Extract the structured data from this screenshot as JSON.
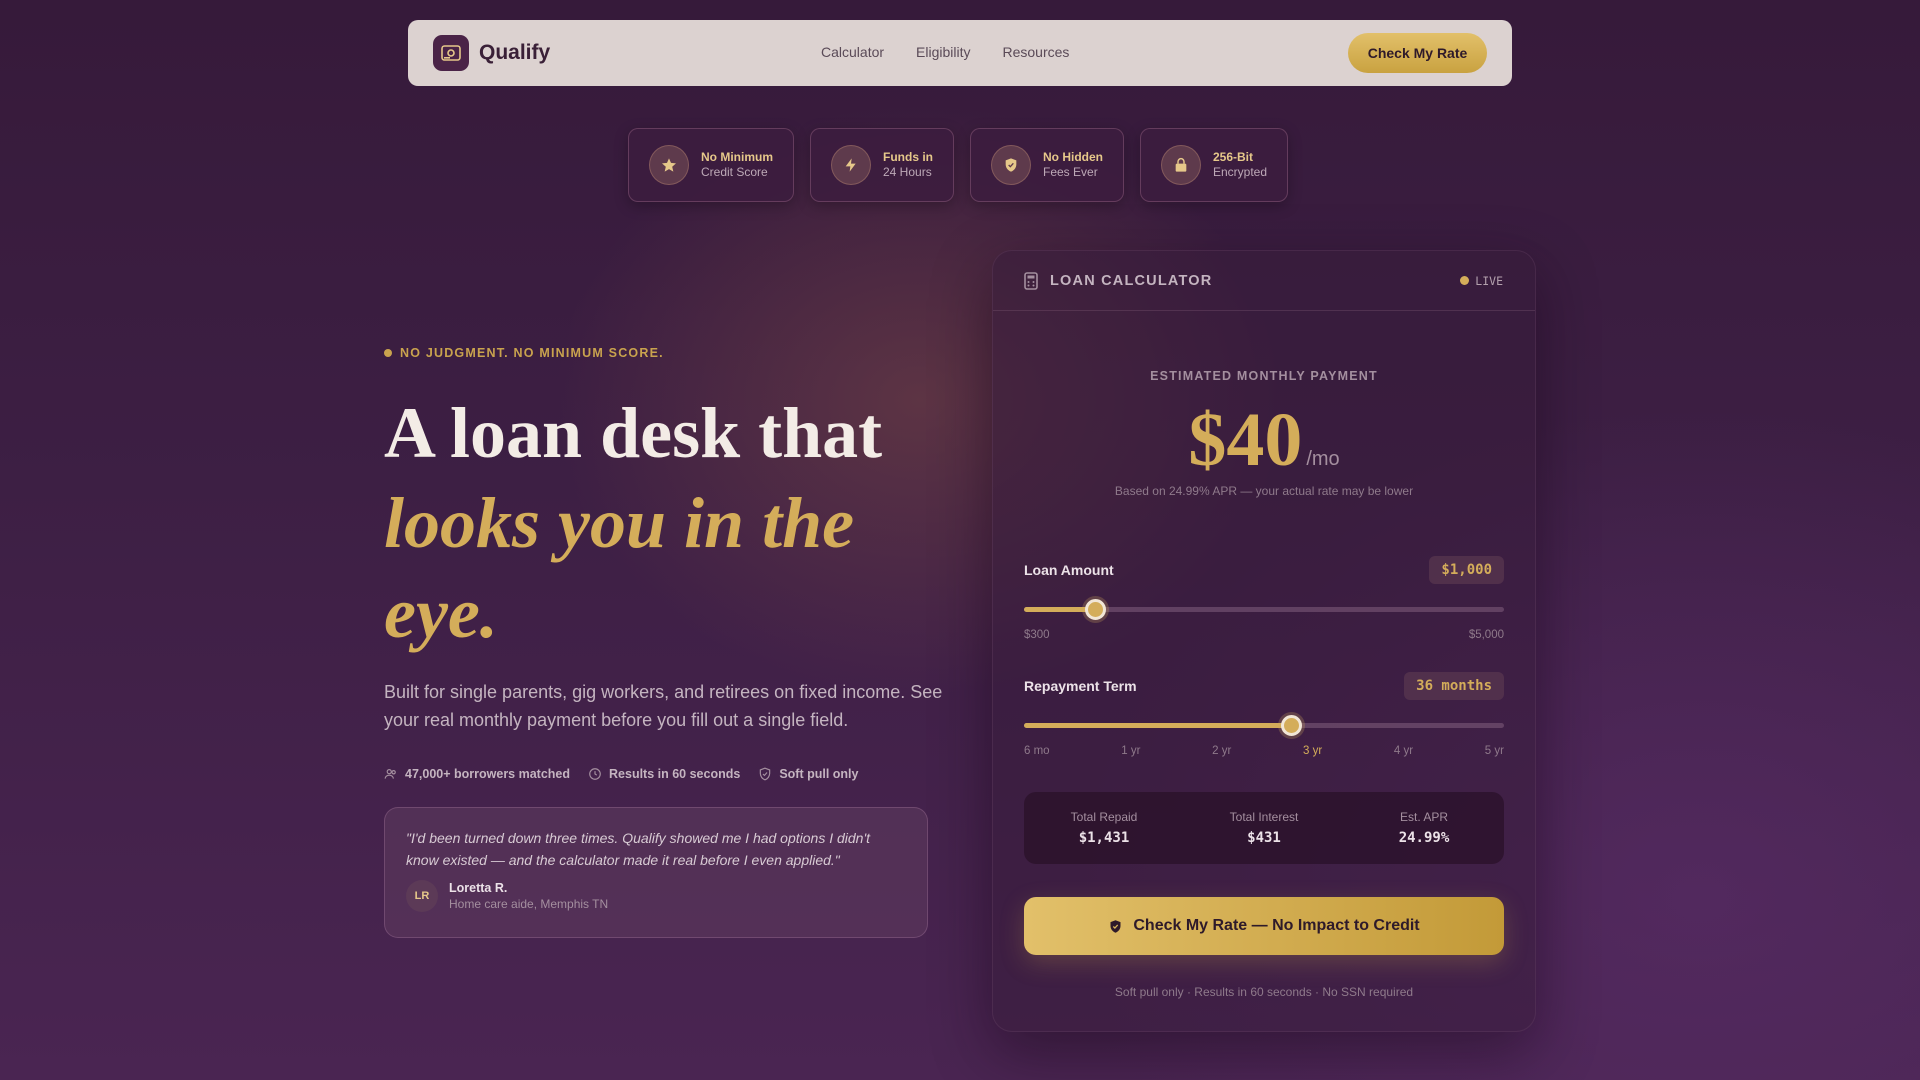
{
  "nav": {
    "brand": "Qualify",
    "links": [
      "Calculator",
      "Eligibility",
      "Resources"
    ],
    "cta": "Check My Rate"
  },
  "badges": [
    {
      "icon": "star-icon",
      "title": "No Minimum",
      "sub": "Credit Score"
    },
    {
      "icon": "lightning-icon",
      "title": "Funds in",
      "sub": "24 Hours"
    },
    {
      "icon": "shield-check-icon",
      "title": "No Hidden",
      "sub": "Fees Ever"
    },
    {
      "icon": "lock-icon",
      "title": "256-Bit",
      "sub": "Encrypted"
    }
  ],
  "hero": {
    "eyebrow": "NO JUDGMENT. NO MINIMUM SCORE.",
    "headline_line1": "A loan desk that",
    "headline_line2": "looks you in the eye.",
    "subhead": "Built for single parents, gig workers, and retirees on fixed income. See your real monthly payment before you fill out a single field.",
    "stats": [
      {
        "icon": "users-icon",
        "text": "47,000+ borrowers matched"
      },
      {
        "icon": "clock-icon",
        "text": "Results in 60 seconds"
      },
      {
        "icon": "shield-icon",
        "text": "Soft pull only"
      }
    ]
  },
  "testimonial": {
    "quote": "\"I'd been turned down three times. Qualify showed me I had options I didn't know existed — and the calculator made it real before I even applied.\"",
    "initials": "LR",
    "name": "Loretta R.",
    "role": "Home care aide, Memphis TN"
  },
  "calculator": {
    "title": "LOAN CALCULATOR",
    "status": "LIVE",
    "payment_label": "ESTIMATED MONTHLY PAYMENT",
    "payment_amount": "$40",
    "payment_suffix": "/mo",
    "payment_note": "Based on 24.99% APR — your actual rate may be lower",
    "loan_amount": {
      "label": "Loan Amount",
      "value": "$1,000",
      "min_label": "$300",
      "max_label": "$5,000",
      "min": 300,
      "max": 5000,
      "current": 1000
    },
    "term": {
      "label": "Repayment Term",
      "value": "36 months",
      "ticks": [
        "6 mo",
        "1 yr",
        "2 yr",
        "3 yr",
        "4 yr",
        "5 yr"
      ],
      "active_tick": 3,
      "min": 6,
      "max": 60,
      "current": 36
    },
    "summary": [
      {
        "label": "Total Repaid",
        "value": "$1,431"
      },
      {
        "label": "Total Interest",
        "value": "$431"
      },
      {
        "label": "Est. APR",
        "value": "24.99%"
      }
    ],
    "cta": "Check My Rate — No Impact to Credit",
    "footnote": "Soft pull only · Results in 60 seconds · No SSN required"
  },
  "colors": {
    "accent": "#d4ad5a",
    "brand_dark": "#4a2347",
    "background": "#3d1f44"
  }
}
